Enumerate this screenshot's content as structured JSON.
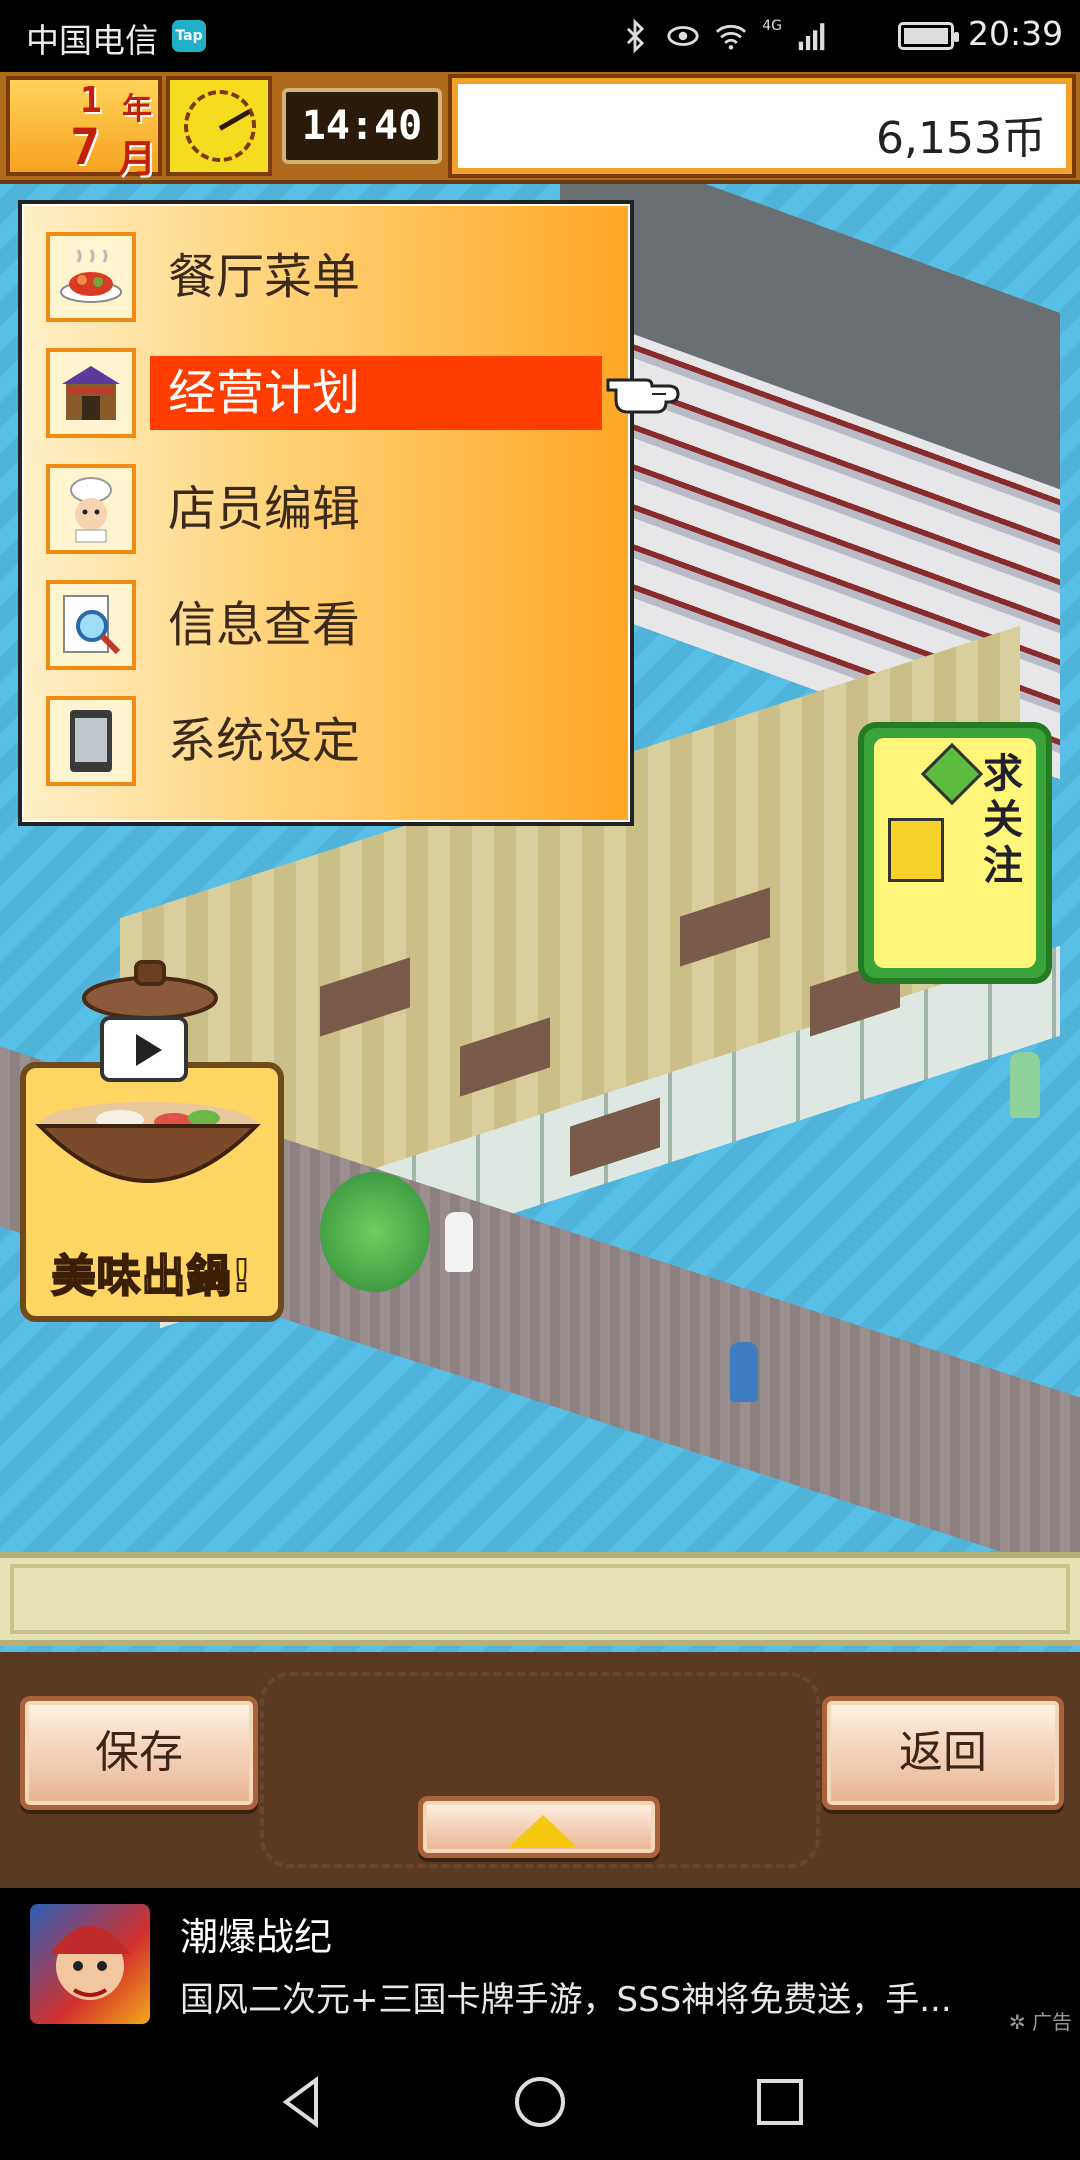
{
  "status_bar": {
    "carrier": "中国电信",
    "tap_badge": "Tap",
    "network_label": "4G",
    "time": "20:39"
  },
  "hud": {
    "year_num": "1",
    "year_unit": "年",
    "month_num": "7",
    "month_unit": "月",
    "game_time": "14:40",
    "coins": "6,153币"
  },
  "menu": {
    "items": [
      {
        "label": "餐厅菜单",
        "icon": "dish-icon"
      },
      {
        "label": "经营计划",
        "icon": "shop-icon"
      },
      {
        "label": "店员编辑",
        "icon": "chef-icon"
      },
      {
        "label": "信息查看",
        "icon": "magnifier-icon"
      },
      {
        "label": "系统设定",
        "icon": "phone-icon"
      }
    ],
    "selected_index": 1
  },
  "follow_sign": {
    "text": "求关注"
  },
  "pot_ad": {
    "text": "美味出鍋!"
  },
  "bottom": {
    "save_label": "保存",
    "back_label": "返回"
  },
  "ad": {
    "title": "潮爆战纪",
    "description": "国风二次元+三国卡牌手游，SSS神将免费送，手...",
    "tag": "广告"
  },
  "colors": {
    "menu_selected": "#ff3d00",
    "hud_border": "#7a3b08",
    "water": "#53b8dd"
  }
}
